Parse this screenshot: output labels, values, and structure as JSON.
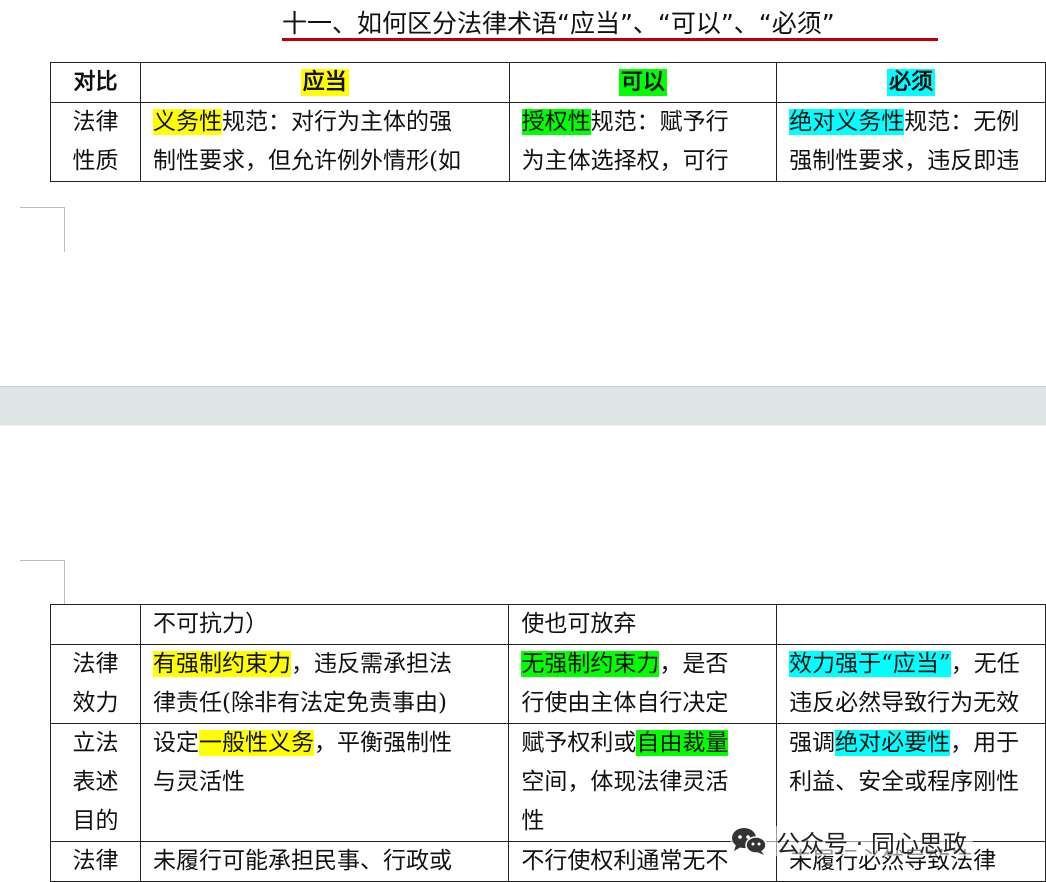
{
  "title": "十一、如何区分法律术语“应当”、“可以”、“必须”",
  "table_page1": {
    "header": {
      "label": "对比",
      "col1": "应当",
      "col2": "可以",
      "col3": "必须"
    },
    "row_nature": {
      "label_l1": "法律",
      "label_l2": "性质",
      "c1_hl": "义务性",
      "c1_rest": "规范：对行为主体的强",
      "c1_l2": "制性要求，但允许例外情形(如",
      "c2_hl": "授权性",
      "c2_rest": "规范：赋予行",
      "c2_l2": "为主体选择权，可行",
      "c3_hl": "绝对义务性",
      "c3_rest": "规范：无例",
      "c3_l2": "强制性要求，违反即违"
    }
  },
  "table_page2": {
    "row_cont": {
      "c1": "不可抗力）",
      "c2": "使也可放弃",
      "c3": ""
    },
    "row_effect": {
      "label_l1": "法律",
      "label_l2": "效力",
      "c1_hl": "有强制约束力",
      "c1_rest": "，违反需承担法",
      "c1_l2": "律责任(除非有法定免责事由)",
      "c2_hl": "无强制约束力",
      "c2_rest": "，是否",
      "c2_l2": "行使由主体自行决定",
      "c3_hl": "效力强于“应当”",
      "c3_rest": "，无任",
      "c3_l2": "违反必然导致行为无效"
    },
    "row_purpose": {
      "label_l1": "立法",
      "label_l2": "表述",
      "label_l3": "目的",
      "c1_pre": "设定",
      "c1_hl": "一般性义务",
      "c1_rest": "，平衡强制性",
      "c1_l2": "与灵活性",
      "c2_pre": "赋予权利或",
      "c2_hl": "自由裁量",
      "c2_l2": "空间，体现法律灵活",
      "c2_l3": "性",
      "c3_pre": "强调",
      "c3_hl": "绝对必要性",
      "c3_rest": "，用于",
      "c3_l2": "利益、安全或程序刚性"
    },
    "row_last": {
      "label_l1": "法律",
      "c1": "未履行可能承担民事、行政或",
      "c2": "不行使权利通常无不",
      "c3": "未履行必然导致法律"
    }
  },
  "watermark": {
    "text": "公众号 · 同心思政",
    "icon": "wechat-icon"
  },
  "colors": {
    "title_underline": "#c00000",
    "highlight_yellow": "#ffff00",
    "highlight_green": "#00ff00",
    "highlight_cyan": "#00ffff",
    "page_gap": "#dfe5e4"
  }
}
